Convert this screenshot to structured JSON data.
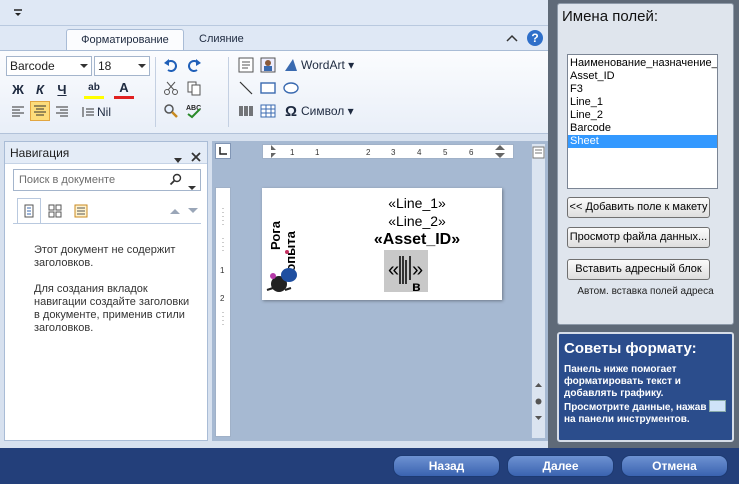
{
  "ribbon": {
    "tabs": [
      "Форматирование",
      "Слияние"
    ],
    "font_name": "Barcode",
    "font_size": "18",
    "bold_label": "Ж",
    "italic_label": "К",
    "underline_label": "Ч",
    "color_a": "А",
    "color_a2": "А",
    "wordart_label": "WordArt",
    "symbol_label": "Символ",
    "nil_label": "Nil"
  },
  "nav": {
    "title": "Навигация",
    "search_placeholder": "Поиск в документе",
    "msg1": "Этот документ не содержит заголовков.",
    "msg2": "Для создания вкладок навигации создайте заголовки в документе, применив стили заголовков."
  },
  "document": {
    "line1": "«Line_1»",
    "line2": "«Line_2»",
    "asset_id": "«Asset_ID»",
    "logo_text": "Рога и копыта",
    "ruler_numbers": [
      "1",
      "1",
      "2",
      "3",
      "4",
      "5",
      "6"
    ],
    "vruler_numbers": [
      "1",
      "2"
    ]
  },
  "fields_panel": {
    "title": "Имена полей:",
    "fields": [
      "Наименование_назначение_",
      "Asset_ID",
      "F3",
      "Line_1",
      "Line_2",
      "Barcode",
      "Sheet"
    ],
    "selected_index": 6,
    "add_button": "<< Добавить поле к макету",
    "preview_button": "Просмотр файла данных...",
    "address_button": "Вставить адресный блок",
    "auto_label": "Автом. вставка полей адреса"
  },
  "tips": {
    "title": "Советы формату:",
    "text1": "Панель ниже помогает форматировать текст и добавлять графику. Просмотрите данные, нажав",
    "text2": "на панели инструментов."
  },
  "buttons": {
    "back": "Назад",
    "next": "Далее",
    "cancel": "Отмена"
  },
  "colors": {
    "accent": "#3399ff",
    "frame": "#233f7a",
    "tips_bg": "#2b4d8c"
  }
}
